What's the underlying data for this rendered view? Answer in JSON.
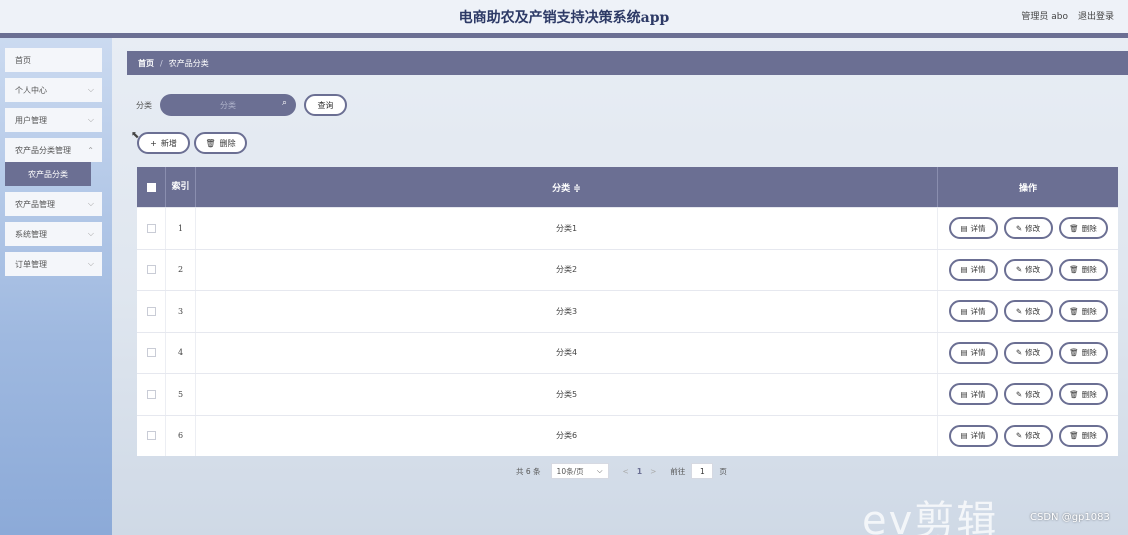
{
  "header": {
    "title": "电商助农及产销支持决策系统app",
    "user": "管理员 abo",
    "logout": "退出登录"
  },
  "sidebar": {
    "items": [
      {
        "label": "首页"
      },
      {
        "label": "个人中心"
      },
      {
        "label": "用户管理"
      },
      {
        "label": "农产品分类管理"
      },
      {
        "label": "农产品分类"
      },
      {
        "label": "农产品管理"
      },
      {
        "label": "系统管理"
      },
      {
        "label": "订单管理"
      }
    ]
  },
  "breadcrumb": {
    "home": "首页",
    "separator": "/",
    "current": "农产品分类"
  },
  "search": {
    "label": "分类",
    "placeholder": "分类",
    "query_button": "查询"
  },
  "toolbar": {
    "add_label": "新增",
    "delete_label": "删除"
  },
  "table": {
    "columns": {
      "index": "索引",
      "category": "分类 ≑",
      "ops": "操作"
    },
    "rows": [
      {
        "index": "1",
        "category": "分类1"
      },
      {
        "index": "2",
        "category": "分类2"
      },
      {
        "index": "3",
        "category": "分类3"
      },
      {
        "index": "4",
        "category": "分类4"
      },
      {
        "index": "5",
        "category": "分类5"
      },
      {
        "index": "6",
        "category": "分类6"
      }
    ],
    "row_actions": {
      "detail": "详情",
      "edit": "修改",
      "delete": "删除"
    }
  },
  "pagination": {
    "total": "共 6 条",
    "page_size": "10条/页",
    "current_page": "1",
    "goto_label": "前往",
    "goto_value": "1",
    "page_suffix": "页"
  },
  "watermarks": {
    "logo": "ev剪辑",
    "csdn": "CSDN @gp1083"
  },
  "colors": {
    "primary": "#6b6f93",
    "header_bg": "#eef2f8",
    "sidebar_top": "#cbdaf0",
    "sidebar_bottom": "#8caad8"
  }
}
